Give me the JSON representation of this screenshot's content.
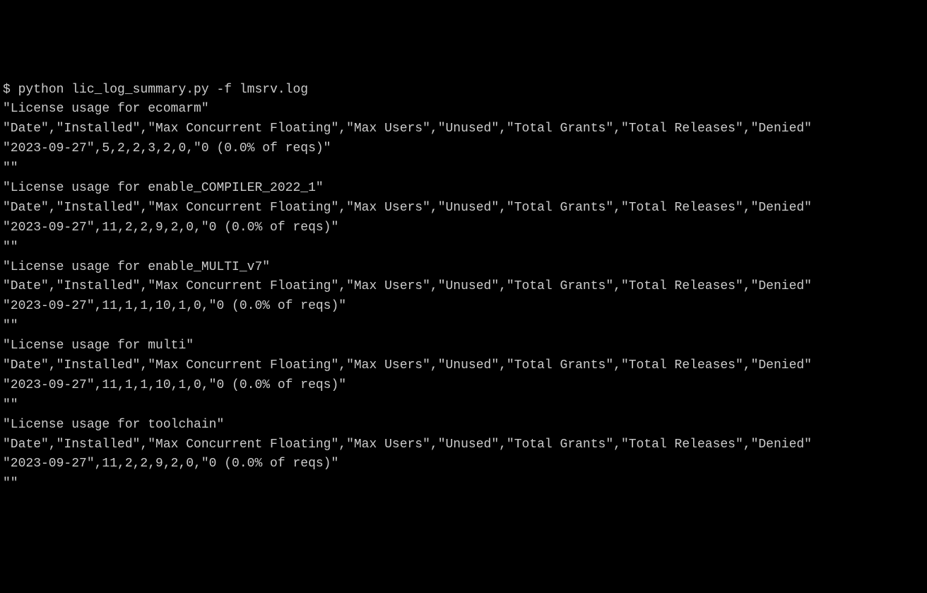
{
  "terminal": {
    "prompt": "$ ",
    "command": "python lic_log_summary.py -f lmsrv.log",
    "blocks": [
      {
        "title": "\"License usage for ecomarm\"",
        "header": "\"Date\",\"Installed\",\"Max Concurrent Floating\",\"Max Users\",\"Unused\",\"Total Grants\",\"Total Releases\",\"Denied\"",
        "data": "\"2023-09-27\",5,2,2,3,2,0,\"0 (0.0% of reqs)\"",
        "blank": "\"\""
      },
      {
        "title": "\"License usage for enable_COMPILER_2022_1\"",
        "header": "\"Date\",\"Installed\",\"Max Concurrent Floating\",\"Max Users\",\"Unused\",\"Total Grants\",\"Total Releases\",\"Denied\"",
        "data": "\"2023-09-27\",11,2,2,9,2,0,\"0 (0.0% of reqs)\"",
        "blank": "\"\""
      },
      {
        "title": "\"License usage for enable_MULTI_v7\"",
        "header": "\"Date\",\"Installed\",\"Max Concurrent Floating\",\"Max Users\",\"Unused\",\"Total Grants\",\"Total Releases\",\"Denied\"",
        "data": "\"2023-09-27\",11,1,1,10,1,0,\"0 (0.0% of reqs)\"",
        "blank": "\"\""
      },
      {
        "title": "\"License usage for multi\"",
        "header": "\"Date\",\"Installed\",\"Max Concurrent Floating\",\"Max Users\",\"Unused\",\"Total Grants\",\"Total Releases\",\"Denied\"",
        "data": "\"2023-09-27\",11,1,1,10,1,0,\"0 (0.0% of reqs)\"",
        "blank": "\"\""
      },
      {
        "title": "\"License usage for toolchain\"",
        "header": "\"Date\",\"Installed\",\"Max Concurrent Floating\",\"Max Users\",\"Unused\",\"Total Grants\",\"Total Releases\",\"Denied\"",
        "data": "\"2023-09-27\",11,2,2,9,2,0,\"0 (0.0% of reqs)\"",
        "blank": "\"\""
      }
    ]
  }
}
